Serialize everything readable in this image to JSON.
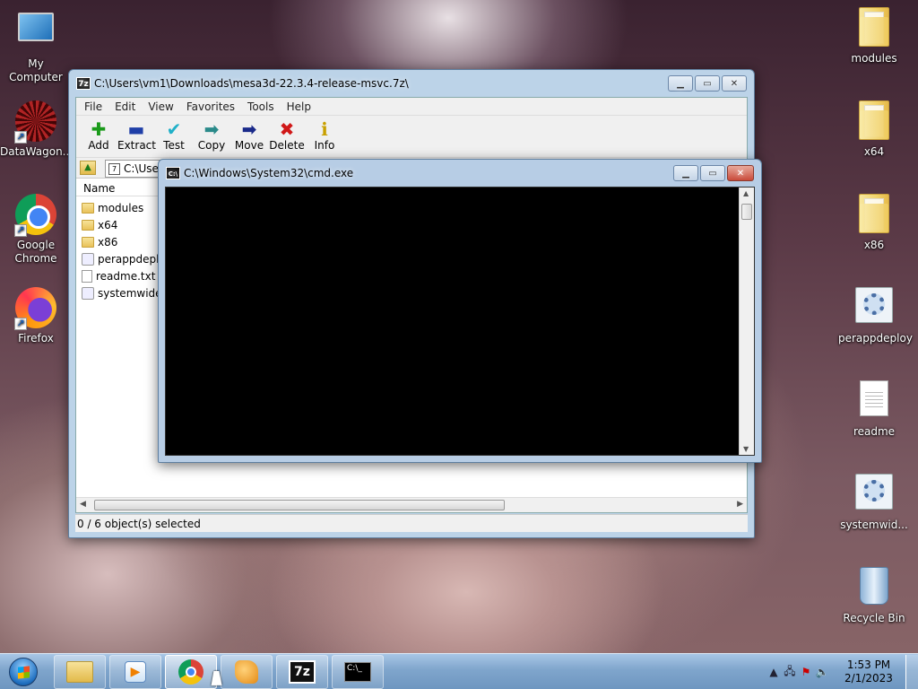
{
  "desktop": {
    "left_icons": [
      {
        "label": "My Computer",
        "icon": "computer-icon"
      },
      {
        "label": "DataWagon...",
        "icon": "datawagon-icon"
      },
      {
        "label": "Google Chrome",
        "icon": "chrome-icon"
      },
      {
        "label": "Firefox",
        "icon": "firefox-icon"
      }
    ],
    "right_icons": [
      {
        "label": "modules",
        "icon": "folder-icon"
      },
      {
        "label": "x64",
        "icon": "folder-icon"
      },
      {
        "label": "x86",
        "icon": "folder-icon"
      },
      {
        "label": "perappdeploy",
        "icon": "settings-file-icon"
      },
      {
        "label": "readme",
        "icon": "text-file-icon"
      },
      {
        "label": "systemwid...",
        "icon": "settings-file-icon"
      },
      {
        "label": "Recycle Bin",
        "icon": "recycle-bin-icon"
      }
    ]
  },
  "sevenzip": {
    "title": "C:\\Users\\vm1\\Downloads\\mesa3d-22.3.4-release-msvc.7z\\",
    "icon_text": "7z",
    "menu": [
      "File",
      "Edit",
      "View",
      "Favorites",
      "Tools",
      "Help"
    ],
    "toolbar": [
      "Add",
      "Extract",
      "Test",
      "Copy",
      "Move",
      "Delete",
      "Info"
    ],
    "address": "C:\\Use",
    "column_name": "Name",
    "files": [
      {
        "name": "modules",
        "type": "folder"
      },
      {
        "name": "x64",
        "type": "folder"
      },
      {
        "name": "x86",
        "type": "folder"
      },
      {
        "name": "perappdeploy",
        "type": "config"
      },
      {
        "name": "readme.txt",
        "type": "text"
      },
      {
        "name": "systemwided",
        "type": "config"
      }
    ],
    "status": "0 / 6 object(s) selected"
  },
  "cmd": {
    "title": "C:\\Windows\\System32\\cmd.exe",
    "icon_text": "C:\\"
  },
  "taskbar": {
    "icon_7z": "7z",
    "time": "1:53 PM",
    "date": "2/1/2023"
  }
}
